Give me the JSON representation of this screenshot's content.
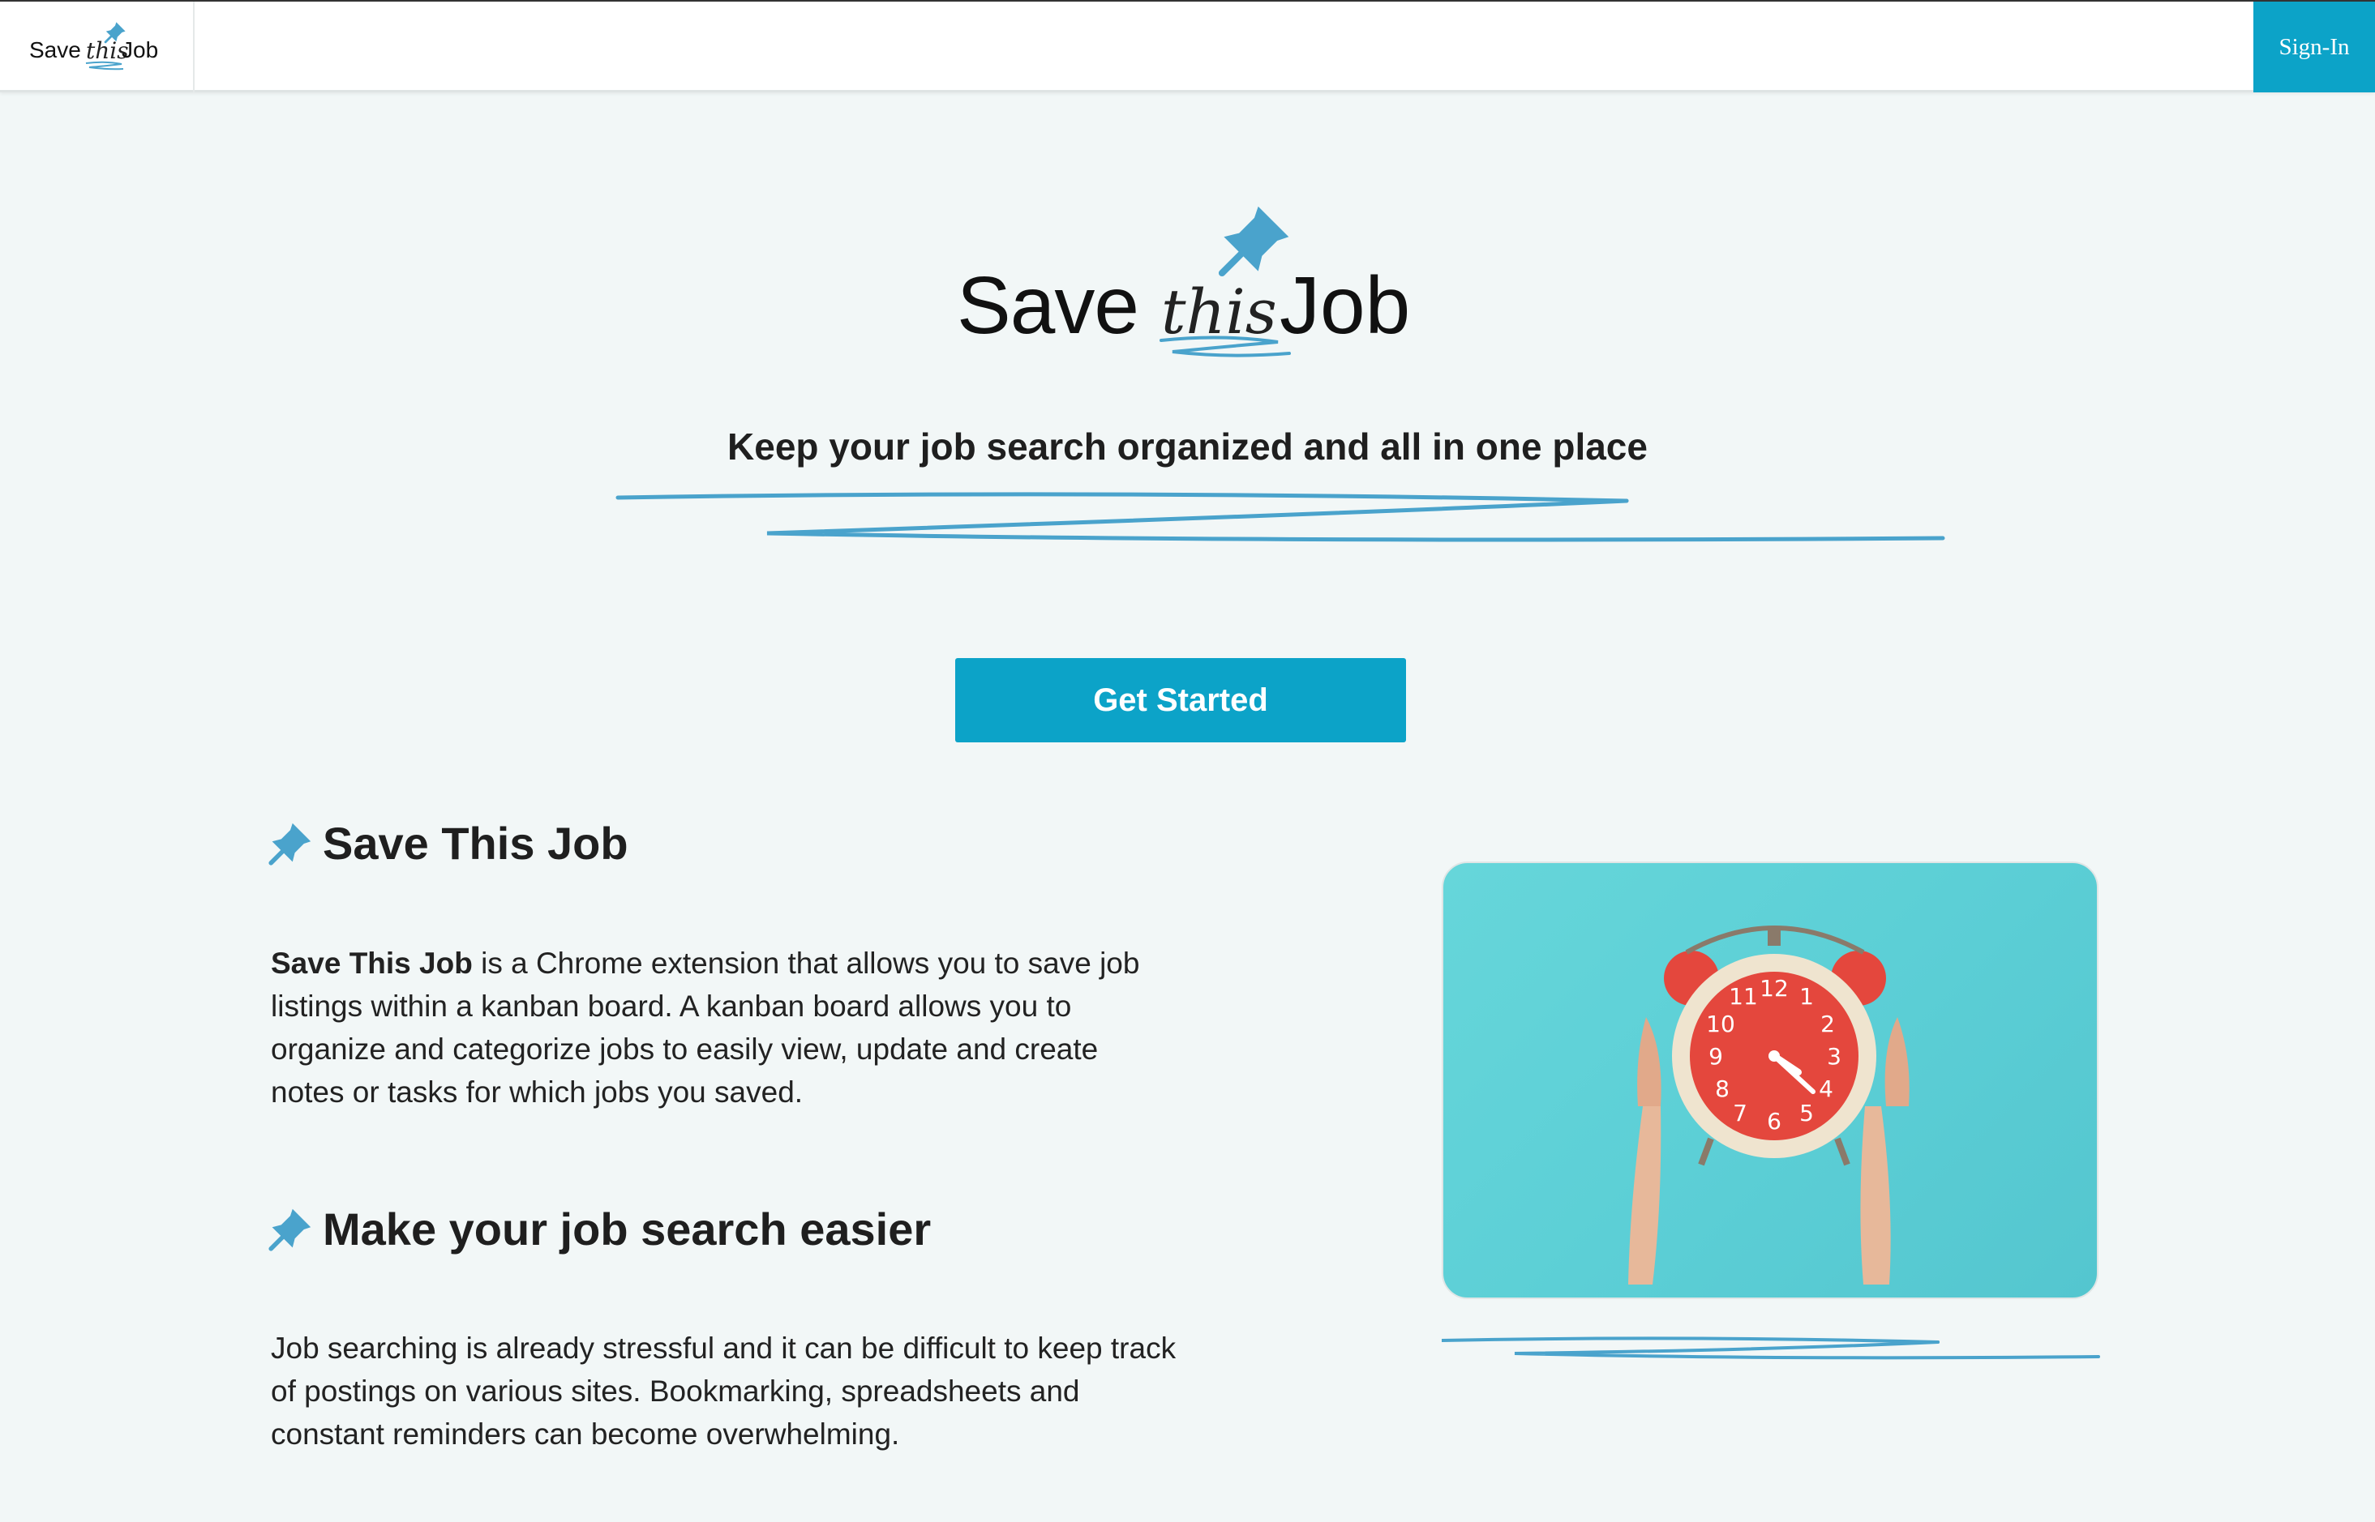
{
  "nav": {
    "logo_save": "Save",
    "logo_this": "this",
    "logo_job": "Job",
    "signin_label": "Sign-In"
  },
  "hero": {
    "logo_save": "Save",
    "logo_this": "this",
    "logo_job": "Job",
    "tagline": "Keep your job search organized and all in one place",
    "cta_label": "Get Started"
  },
  "sections": [
    {
      "heading": "Save This Job",
      "body_bold": "Save This Job",
      "body_rest": " is a Chrome extension that allows you to save job listings within a kanban board. A kanban board allows you to organize and categorize jobs to easily view, update and create notes or tasks for which jobs you saved."
    },
    {
      "heading": "Make your job search easier",
      "body": "Job searching is already stressful and it can be difficult to keep track of postings on various sites. Bookmarking, spreadsheets and constant reminders can become overwhelming."
    }
  ],
  "clock_numbers": [
    "12",
    "1",
    "2",
    "3",
    "4",
    "5",
    "6",
    "7",
    "8",
    "9",
    "10",
    "11"
  ],
  "colors": {
    "accent": "#0ca3c8",
    "pin": "#4aa3cc",
    "background": "#f2f7f7",
    "photo_bg": "#5ccfd6",
    "clock_face": "#e4473d"
  },
  "icons": [
    "pushpin-icon"
  ]
}
